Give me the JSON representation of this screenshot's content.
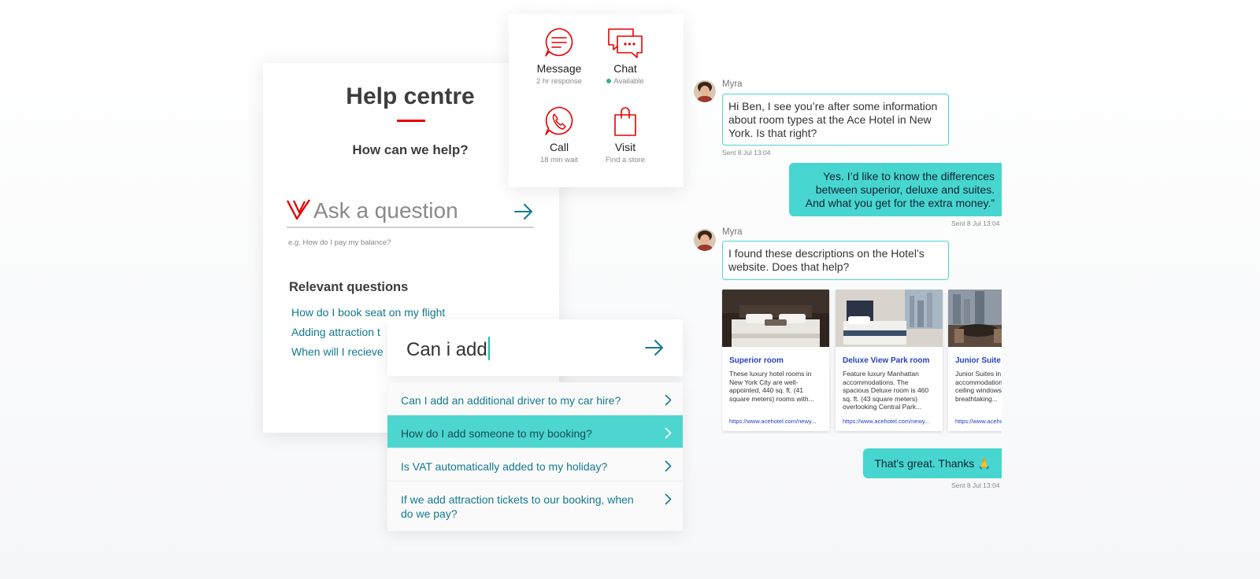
{
  "help": {
    "title": "Help centre",
    "subtitle": "How can we help?",
    "ask_placeholder": "Ask a question",
    "ask_hint": "e.g. How do I pay my balance?",
    "relevant_title": "Relevant questions",
    "relevant": [
      "How do I book seat on my flight",
      "Adding attraction t",
      "When will I recieve"
    ]
  },
  "contact": {
    "options": [
      {
        "label": "Message",
        "sub": "2 hr response",
        "icon": "message-icon"
      },
      {
        "label": "Chat",
        "sub": "Available",
        "icon": "chat-icon"
      },
      {
        "label": "Call",
        "sub": "18 min wait",
        "icon": "phone-icon"
      },
      {
        "label": "Visit",
        "sub": "Find a store",
        "icon": "shopping-bag-icon"
      }
    ]
  },
  "search": {
    "query": "Can i add",
    "suggestions": [
      "Can I add an additional driver to my car hire?",
      "How do I add someone to my booking?",
      "Is VAT automatically added to my holiday?",
      "If we add attraction tickets to our booking, when do we pay?"
    ]
  },
  "chat": {
    "agent_name": "Myra",
    "msg1": "Hi Ben, I see you’re after some information about room types at the Ace Hotel in New York. Is that right?",
    "ts1": "Sent 8 Jul 13:04",
    "reply1": "Yes. I’d like to know the differences between superior, deluxe and suites. And what you get for the extra money.”",
    "ts2": "Sent 8 Jul 13:04",
    "msg2": "I found these descriptions on the Hotel’s website. Does that help?",
    "cards": [
      {
        "title": "Superior room",
        "desc": "These luxury hotel rooms in New York City are well-appointed, 440 sq. ft. (41 square meters) rooms with...",
        "url": "https://www.acehotel.com/newy..."
      },
      {
        "title": "Deluxe View Park room",
        "desc": "Feature luxury Manhattan accommodations. The spacious Deluxe room is 460 sq. ft. (43 square meters) overlooking Central Park...",
        "url": "https://www.acehotel.com/newy..."
      },
      {
        "title": "Junior Suite",
        "desc": "Junior Suites in Manhattan are accommodations with floor-to-ceiling windows offering a breathtaking...",
        "url": "https://www.acehotel.com/newy..."
      }
    ],
    "reply2": "That's great. Thanks 🙏",
    "ts3": "Sent 8 Jul 13:04"
  },
  "colors": {
    "brand_red": "#e60000",
    "teal": "#4dd6d0",
    "link": "#127a8e"
  }
}
